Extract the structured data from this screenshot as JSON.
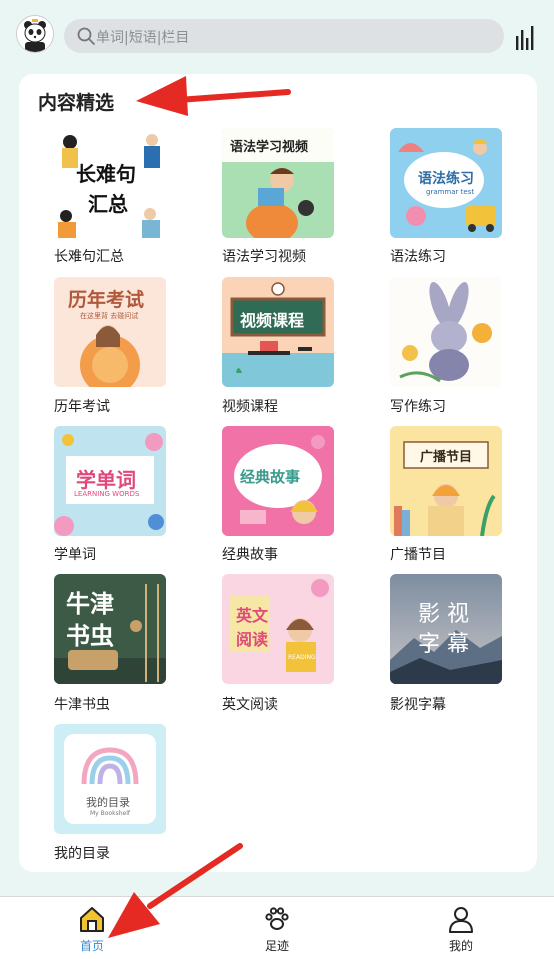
{
  "search": {
    "placeholder": "单词|短语|栏目"
  },
  "section": {
    "title": "内容精选"
  },
  "tiles": [
    {
      "label": "长难句汇总",
      "cover": "长难句汇总"
    },
    {
      "label": "语法学习视频",
      "cover": "语法学习视频"
    },
    {
      "label": "语法练习",
      "cover": "语法练习",
      "cover_sub": "grammar test"
    },
    {
      "label": "历年考试",
      "cover": "历年考试",
      "cover_sub": "在这里背 去碰问试"
    },
    {
      "label": "视频课程",
      "cover": "视频课程"
    },
    {
      "label": "写作练习"
    },
    {
      "label": "学单词",
      "cover": "学单词",
      "cover_sub": "LEARNING WORDS"
    },
    {
      "label": "经典故事",
      "cover": "经典故事"
    },
    {
      "label": "广播节目",
      "cover": "广播节目"
    },
    {
      "label": "牛津书虫",
      "cover": "牛津书虫"
    },
    {
      "label": "英文阅读",
      "cover": "英文阅读",
      "cover_sub": "READING"
    },
    {
      "label": "影视字幕",
      "cover": "影视字幕"
    },
    {
      "label": "我的目录",
      "cover": "我的目录",
      "cover_sub": "My Bookshelf"
    }
  ],
  "nav": [
    {
      "label": "首页",
      "icon": "home-icon",
      "active": true
    },
    {
      "label": "足迹",
      "icon": "paw-icon",
      "active": false
    },
    {
      "label": "我的",
      "icon": "person-icon",
      "active": false
    }
  ],
  "colors": {
    "accent": "#3a8bd0",
    "background": "#eaf6f4",
    "arrow": "#e52a23"
  }
}
